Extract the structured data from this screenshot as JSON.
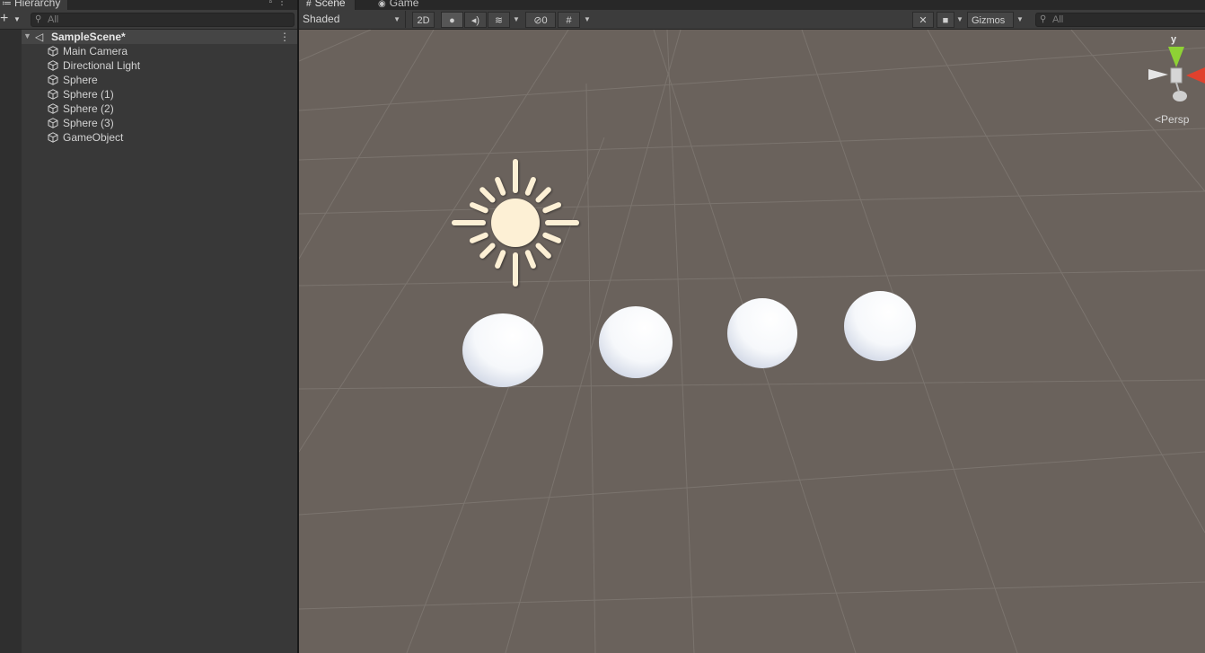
{
  "hierarchy": {
    "tab_label": "Hierarchy",
    "add_label": "+",
    "search_placeholder": "All",
    "scene_name": "SampleScene*",
    "items": [
      {
        "label": "Main Camera"
      },
      {
        "label": "Directional Light"
      },
      {
        "label": "Sphere"
      },
      {
        "label": "Sphere (1)"
      },
      {
        "label": "Sphere (2)"
      },
      {
        "label": "Sphere (3)"
      },
      {
        "label": "GameObject"
      }
    ]
  },
  "scene_view": {
    "tabs": [
      {
        "label": "Scene",
        "icon": "grid-icon"
      },
      {
        "label": "Game",
        "icon": "gamepad-icon"
      }
    ],
    "toolbar": {
      "shading_mode": "Shaded",
      "mode_2d_label": "2D",
      "hidden_count": "0",
      "gizmos_label": "Gizmos",
      "search_placeholder": "All"
    },
    "orientation_gizmo": {
      "axis_label": "y",
      "projection_label": "Persp"
    }
  },
  "colors": {
    "panel_bg": "#383838",
    "toolbar_bg": "#3c3c3c",
    "viewport_bg": "#6a625c",
    "sun_color": "#fdf0d5",
    "x_axis": "#e0412d",
    "y_axis": "#8ed135",
    "z_axis": "#e5e5e5"
  }
}
